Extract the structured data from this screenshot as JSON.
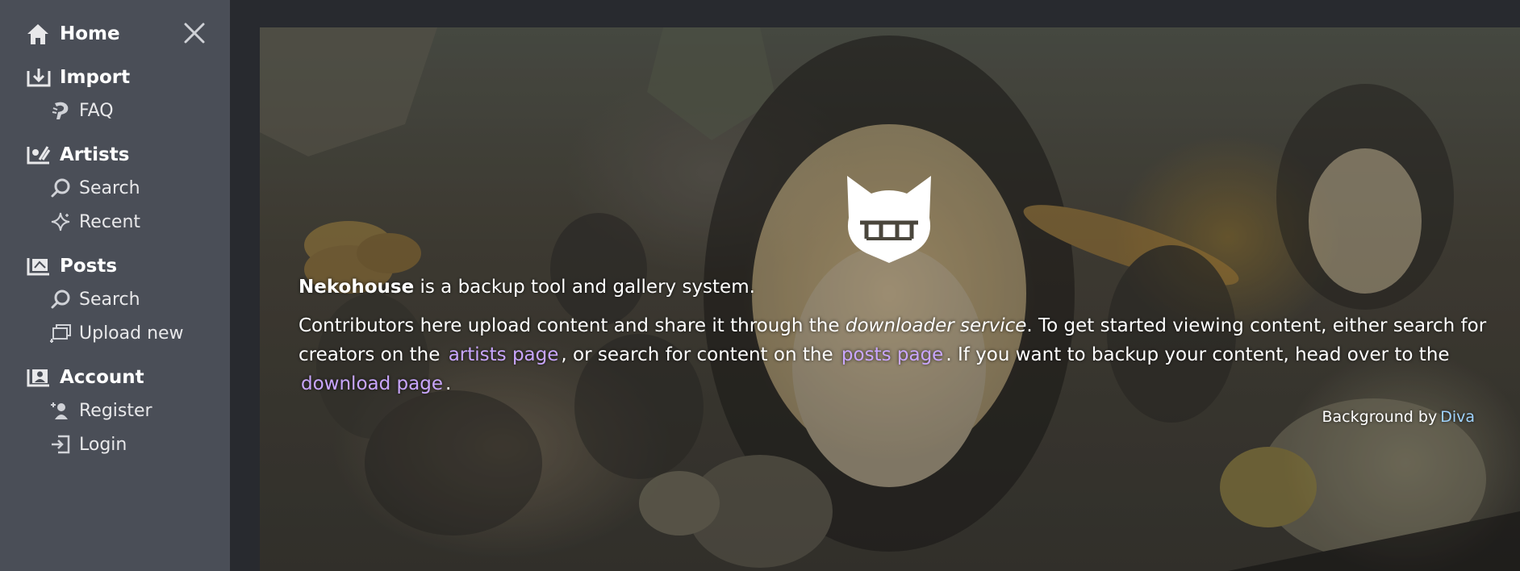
{
  "sidebar": {
    "close_icon": "close-icon",
    "home": {
      "label": "Home",
      "icon": "home-icon"
    },
    "import": {
      "label": "Import",
      "icon": "import-icon",
      "items": [
        {
          "label": "FAQ",
          "icon": "faq-icon"
        }
      ]
    },
    "artists": {
      "label": "Artists",
      "icon": "artists-icon",
      "items": [
        {
          "label": "Search",
          "icon": "search-icon"
        },
        {
          "label": "Recent",
          "icon": "sparkle-icon"
        }
      ]
    },
    "posts": {
      "label": "Posts",
      "icon": "posts-icon",
      "items": [
        {
          "label": "Search",
          "icon": "search-icon"
        },
        {
          "label": "Upload new",
          "icon": "upload-icon"
        }
      ]
    },
    "account": {
      "label": "Account",
      "icon": "account-icon",
      "items": [
        {
          "label": "Register",
          "icon": "register-icon"
        },
        {
          "label": "Login",
          "icon": "login-icon"
        }
      ]
    }
  },
  "hero": {
    "brand": "Nekohouse",
    "tagline": " is a backup tool and gallery system.",
    "intro_1": "Contributors here upload content and share it through the ",
    "intro_service": "downloader service",
    "intro_2": ". To get started viewing content, either search for creators on the ",
    "artists_link": "artists page",
    "intro_3": ", or search for content on the ",
    "posts_link": "posts page",
    "intro_4": ". If you want to backup your content, head over to the ",
    "download_link": "download page",
    "intro_5": ".",
    "credit_prefix": "Background by",
    "credit_link": "Diva"
  },
  "colors": {
    "sidebar_bg": "#4a4e57",
    "page_bg": "#282a2f",
    "link": "#c9a6ff",
    "credit_link": "#9fd3ff"
  }
}
